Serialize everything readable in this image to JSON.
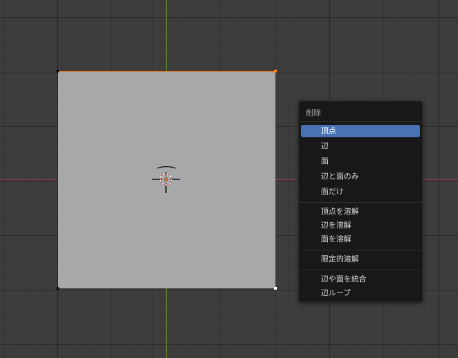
{
  "menu": {
    "title": "削除",
    "items": [
      {
        "label": "頂点"
      },
      {
        "label": "辺"
      },
      {
        "label": "面"
      },
      {
        "label": "辺と面のみ"
      },
      {
        "label": "面だけ"
      },
      {
        "label": "頂点を溶解"
      },
      {
        "label": "辺を溶解"
      },
      {
        "label": "面を溶解"
      },
      {
        "label": "限定的溶解"
      },
      {
        "label": "辺や面を統合"
      },
      {
        "label": "辺ループ"
      }
    ],
    "highlighted_index": 0
  },
  "colors": {
    "viewport_bg": "#3d3d3d",
    "grid_line": "#333333",
    "x_axis": "#9a3d45",
    "y_axis": "#6f8f2a",
    "plane_fill": "#a7a8aa",
    "selection_edge": "#e07a1f",
    "menu_bg": "#181818",
    "menu_highlight": "#4772b3"
  },
  "icons": [
    "3d-cursor-icon"
  ]
}
